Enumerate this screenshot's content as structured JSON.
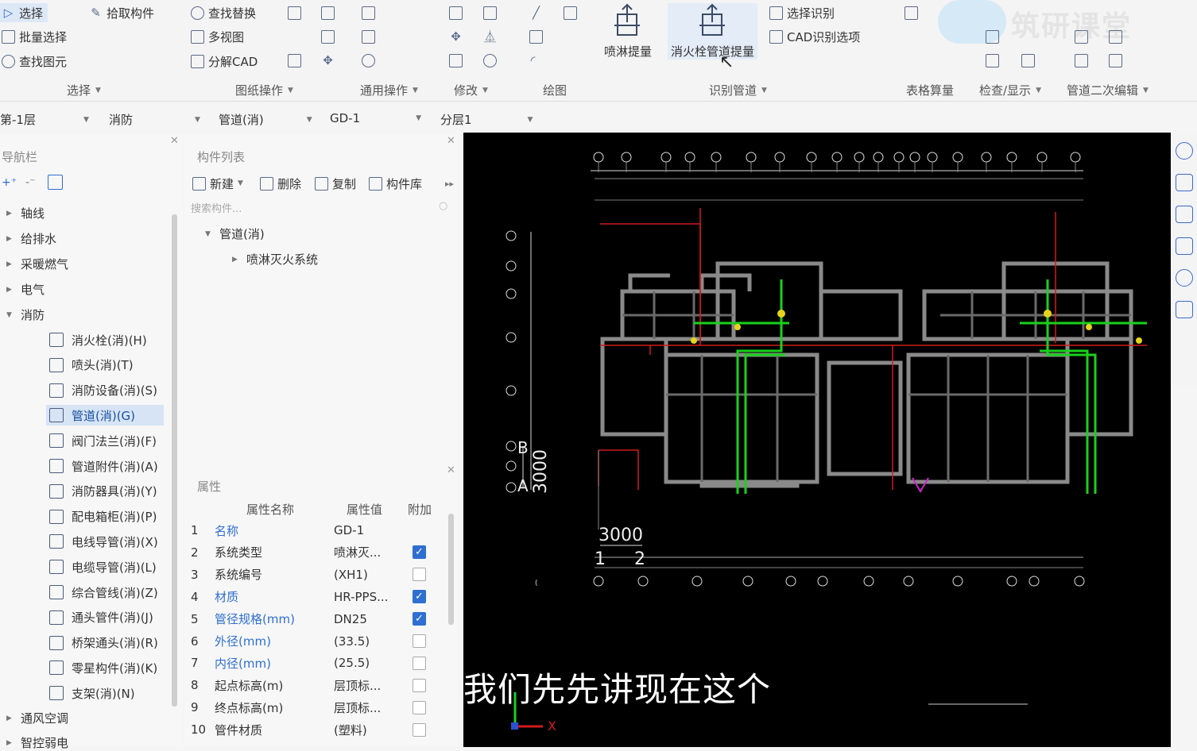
{
  "ribbon": {
    "select_group": {
      "select": "选择",
      "pick": "拾取构件",
      "batch": "批量选择",
      "find": "查找图元",
      "label": "选择"
    },
    "drawing_group": {
      "find_replace": "查找替换",
      "multiview": "多视图",
      "decompose": "分解CAD",
      "label": "图纸操作"
    },
    "common_group": {
      "label": "通用操作"
    },
    "modify_group": {
      "label": "修改"
    },
    "draw_group": {
      "label": "绘图"
    },
    "identify_group": {
      "sprinkler": "喷淋提量",
      "hydrant_pipe": "消火栓管道提量",
      "select_identify": "选择识别",
      "cad_options": "CAD识别选项",
      "label": "识别管道"
    },
    "table_group": {
      "label": "表格算量"
    },
    "check_group": {
      "label": "检查/显示"
    },
    "edit_group": {
      "label": "管道二次编辑"
    },
    "watermark": "筑研课堂"
  },
  "filter": {
    "floor": "第-1层",
    "discipline": "消防",
    "type": "管道(消)",
    "item": "GD-1",
    "layer": "分层1"
  },
  "nav": {
    "title": "导航栏",
    "items": [
      {
        "label": "轴线"
      },
      {
        "label": "给排水"
      },
      {
        "label": "采暖燃气"
      },
      {
        "label": "电气"
      },
      {
        "label": "消防"
      }
    ],
    "sub": [
      {
        "label": "消火栓(消)(H)"
      },
      {
        "label": "喷头(消)(T)"
      },
      {
        "label": "消防设备(消)(S)"
      },
      {
        "label": "管道(消)(G)"
      },
      {
        "label": "阀门法兰(消)(F)"
      },
      {
        "label": "管道附件(消)(A)"
      },
      {
        "label": "消防器具(消)(Y)"
      },
      {
        "label": "配电箱柜(消)(P)"
      },
      {
        "label": "电线导管(消)(X)"
      },
      {
        "label": "电缆导管(消)(L)"
      },
      {
        "label": "综合管线(消)(Z)"
      },
      {
        "label": "通头管件(消)(J)"
      },
      {
        "label": "桥架通头(消)(R)"
      },
      {
        "label": "零星构件(消)(K)"
      },
      {
        "label": "支架(消)(N)"
      }
    ],
    "after": [
      {
        "label": "通风空调"
      },
      {
        "label": "智控弱电"
      }
    ]
  },
  "components": {
    "title": "构件列表",
    "new": "新建",
    "delete": "删除",
    "copy": "复制",
    "library": "构件库",
    "search_placeholder": "搜索构件...",
    "tree_root": "管道(消)",
    "tree_child": "喷淋灭火系统"
  },
  "properties": {
    "title": "属性",
    "col_name": "属性名称",
    "col_value": "属性值",
    "col_extra": "附加",
    "rows": [
      {
        "n": "1",
        "k": "名称",
        "v": "GD-1",
        "blue": true,
        "chk": null
      },
      {
        "n": "2",
        "k": "系统类型",
        "v": "喷淋灭...",
        "blue": false,
        "chk": true
      },
      {
        "n": "3",
        "k": "系统编号",
        "v": "(XH1)",
        "blue": false,
        "chk": false
      },
      {
        "n": "4",
        "k": "材质",
        "v": "HR-PPS...",
        "blue": true,
        "chk": true
      },
      {
        "n": "5",
        "k": "管径规格(mm)",
        "v": "DN25",
        "blue": true,
        "chk": true
      },
      {
        "n": "6",
        "k": "外径(mm)",
        "v": "(33.5)",
        "blue": true,
        "chk": false
      },
      {
        "n": "7",
        "k": "内径(mm)",
        "v": "(25.5)",
        "blue": true,
        "chk": false
      },
      {
        "n": "8",
        "k": "起点标高(m)",
        "v": "层顶标...",
        "blue": false,
        "chk": false
      },
      {
        "n": "9",
        "k": "终点标高(m)",
        "v": "层顶标...",
        "blue": false,
        "chk": false
      },
      {
        "n": "10",
        "k": "管件材质",
        "v": "(塑料)",
        "blue": false,
        "chk": false
      }
    ]
  },
  "canvas": {
    "dim_vertical": "3000",
    "dim_horizontal": "3000",
    "axis_b": "B",
    "axis_a": "A",
    "axis_1": "1",
    "axis_2": "2",
    "axis_x": "X"
  },
  "subtitle": "我们先先讲现在这个"
}
